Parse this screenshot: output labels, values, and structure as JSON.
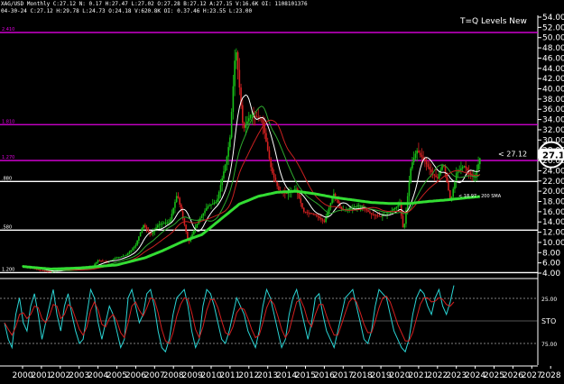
{
  "header": {
    "line1": "XAG/USD Monthly C:27.12 N: 0.17 H:27.47 L:27.02 O:27.28 B:27.12 A:27.15 V:16.6K OI: 1108101376",
    "line2": "04-30-24 C:27.12 H:29.78 L:24.73 O:24.18 V:620.8K OI: 0.37.46 H:23.55 L:23.00"
  },
  "chart_data": [
    {
      "type": "candlestick",
      "title": "T=Q Levels New",
      "x_ticks": [
        "2000",
        "2001",
        "2002",
        "2003",
        "2004",
        "2005",
        "2006",
        "2007",
        "2008",
        "2009",
        "2010",
        "2011",
        "2012",
        "2013",
        "2014",
        "2015",
        "2016",
        "2017",
        "2018",
        "2019",
        "2020",
        "2021",
        "2022",
        "2023",
        "2024",
        "2025",
        "2026",
        "2027",
        "2028"
      ],
      "y_ticks": [
        "54.00",
        "52.00",
        "50.00",
        "48.00",
        "46.00",
        "44.00",
        "42.00",
        "40.00",
        "38.00",
        "36.00",
        "34.00",
        "32.00",
        "30.00",
        "28.00",
        "26.00",
        "24.00",
        "22.00",
        "20.00",
        "18.00",
        "16.00",
        "14.00",
        "12.00",
        "10.00",
        "8.00",
        "6.00",
        "4.00"
      ],
      "ylim": [
        4,
        54
      ],
      "last_price": "27.12",
      "last_price_label": "< 27.12",
      "sma_label": "< 18.97 - 200 SMA",
      "levels": [
        {
          "value": 51.0,
          "label": "2.410",
          "color": "#e000e0"
        },
        {
          "value": 33.0,
          "label": "1.810",
          "color": "#e000e0"
        },
        {
          "value": 26.0,
          "label": "1.270",
          "color": "#e000e0"
        },
        {
          "value": 21.9,
          "label": ".880",
          "color": "#ffffff"
        },
        {
          "value": 12.4,
          "label": ".580",
          "color": "#ffffff"
        },
        {
          "value": 4.1,
          "label": "1.200",
          "color": "#ffffff"
        }
      ],
      "price_anchors": [
        [
          2000.0,
          5.4
        ],
        [
          2001.0,
          4.5
        ],
        [
          2001.5,
          4.3
        ],
        [
          2002.0,
          4.6
        ],
        [
          2003.0,
          4.9
        ],
        [
          2003.7,
          5.3
        ],
        [
          2004.0,
          6.5
        ],
        [
          2004.5,
          6.2
        ],
        [
          2005.0,
          7.0
        ],
        [
          2005.5,
          7.5
        ],
        [
          2006.0,
          9.5
        ],
        [
          2006.4,
          13.5
        ],
        [
          2006.8,
          11.5
        ],
        [
          2007.2,
          13.5
        ],
        [
          2007.8,
          14.0
        ],
        [
          2008.2,
          19.5
        ],
        [
          2008.8,
          10.0
        ],
        [
          2009.3,
          14.0
        ],
        [
          2009.8,
          17.0
        ],
        [
          2010.3,
          18.0
        ],
        [
          2010.8,
          26.0
        ],
        [
          2011.0,
          30.5
        ],
        [
          2011.3,
          48.5
        ],
        [
          2011.7,
          32.0
        ],
        [
          2012.1,
          35.0
        ],
        [
          2012.7,
          34.0
        ],
        [
          2013.2,
          24.0
        ],
        [
          2013.6,
          20.0
        ],
        [
          2014.0,
          19.5
        ],
        [
          2014.5,
          20.5
        ],
        [
          2014.9,
          16.0
        ],
        [
          2015.5,
          15.5
        ],
        [
          2016.0,
          14.0
        ],
        [
          2016.5,
          19.5
        ],
        [
          2016.9,
          16.5
        ],
        [
          2017.5,
          16.5
        ],
        [
          2018.0,
          17.0
        ],
        [
          2018.5,
          15.5
        ],
        [
          2019.0,
          15.0
        ],
        [
          2019.5,
          16.0
        ],
        [
          2020.0,
          17.5
        ],
        [
          2020.2,
          12.0
        ],
        [
          2020.6,
          25.0
        ],
        [
          2020.9,
          28.0
        ],
        [
          2021.3,
          26.0
        ],
        [
          2021.7,
          23.5
        ],
        [
          2022.0,
          22.5
        ],
        [
          2022.3,
          25.5
        ],
        [
          2022.7,
          18.0
        ],
        [
          2023.0,
          23.5
        ],
        [
          2023.4,
          25.0
        ],
        [
          2023.8,
          23.0
        ],
        [
          2024.0,
          23.0
        ],
        [
          2024.3,
          27.1
        ]
      ],
      "sma_anchors": [
        [
          2000.0,
          5.3
        ],
        [
          2001.5,
          4.8
        ],
        [
          2003.0,
          5.0
        ],
        [
          2005.0,
          5.6
        ],
        [
          2006.5,
          7.0
        ],
        [
          2007.5,
          8.5
        ],
        [
          2008.5,
          10.2
        ],
        [
          2009.5,
          11.5
        ],
        [
          2010.5,
          14.5
        ],
        [
          2011.5,
          17.5
        ],
        [
          2012.5,
          19.0
        ],
        [
          2013.5,
          19.8
        ],
        [
          2014.5,
          20.0
        ],
        [
          2015.5,
          19.5
        ],
        [
          2016.5,
          18.8
        ],
        [
          2017.5,
          18.3
        ],
        [
          2018.5,
          17.8
        ],
        [
          2019.5,
          17.6
        ],
        [
          2020.5,
          17.6
        ],
        [
          2021.5,
          18.0
        ],
        [
          2022.5,
          18.3
        ],
        [
          2023.5,
          18.7
        ],
        [
          2024.3,
          18.97
        ]
      ]
    },
    {
      "type": "line",
      "title": "STO",
      "y_ticks": [
        "25.00",
        "75.00"
      ],
      "series": [
        {
          "color": "#2ad4d4",
          "values": [
            50,
            30,
            20,
            60,
            80,
            50,
            40,
            70,
            85,
            60,
            30,
            50,
            70,
            90,
            60,
            40,
            70,
            85,
            60,
            40,
            25,
            30,
            60,
            90,
            80,
            50,
            30,
            50,
            70,
            60,
            40,
            20,
            30,
            80,
            90,
            70,
            50,
            60,
            85,
            90,
            70,
            40,
            20,
            15,
            30,
            60,
            80,
            85,
            90,
            70,
            40,
            20,
            30,
            70,
            90,
            85,
            70,
            50,
            30,
            25,
            40,
            60,
            80,
            70,
            60,
            40,
            30,
            20,
            40,
            70,
            90,
            80,
            60,
            40,
            20,
            30,
            60,
            80,
            90,
            70,
            50,
            30,
            50,
            80,
            85,
            60,
            40,
            30,
            20,
            40,
            60,
            80,
            85,
            90,
            70,
            50,
            30,
            25,
            40,
            70,
            90,
            85,
            80,
            60,
            40,
            30,
            20,
            15,
            30,
            60,
            80,
            90,
            85,
            70,
            60,
            80,
            90,
            70,
            60,
            75,
            95
          ]
        },
        {
          "color": "#d42020",
          "values": [
            50,
            42,
            35,
            45,
            60,
            62,
            55,
            60,
            70,
            68,
            55,
            50,
            58,
            72,
            70,
            55,
            60,
            72,
            68,
            55,
            42,
            35,
            45,
            65,
            75,
            65,
            48,
            45,
            55,
            60,
            52,
            38,
            32,
            50,
            70,
            75,
            65,
            58,
            68,
            80,
            78,
            62,
            42,
            28,
            25,
            38,
            58,
            72,
            80,
            78,
            62,
            42,
            32,
            45,
            65,
            78,
            78,
            68,
            52,
            38,
            35,
            45,
            62,
            68,
            66,
            55,
            42,
            32,
            35,
            50,
            68,
            78,
            72,
            58,
            42,
            32,
            40,
            58,
            75,
            78,
            68,
            52,
            45,
            60,
            72,
            72,
            58,
            45,
            35,
            35,
            48,
            62,
            75,
            80,
            75,
            62,
            48,
            38,
            38,
            52,
            68,
            80,
            82,
            75,
            62,
            48,
            38,
            28,
            28,
            38,
            55,
            72,
            80,
            80,
            75,
            76,
            80,
            78,
            72,
            70,
            75
          ]
        }
      ]
    }
  ]
}
